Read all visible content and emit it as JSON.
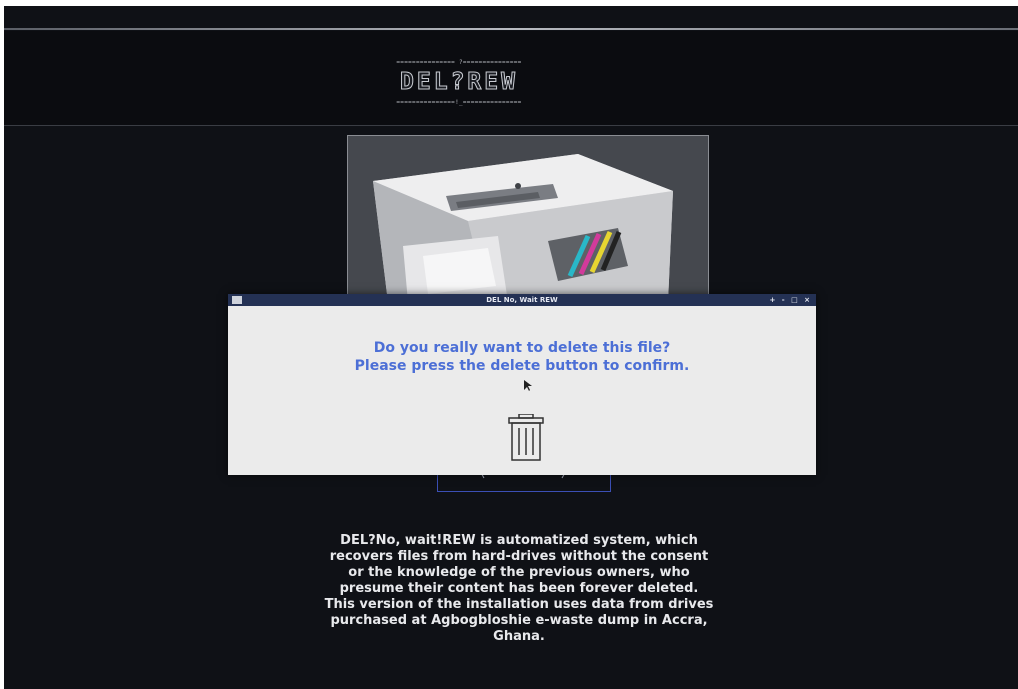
{
  "header": {
    "logo_top_rule": "=============== ?===============",
    "logo_text": "DEL?REW",
    "logo_bottom_rule": "===============!_==============="
  },
  "dialog": {
    "title": "DEL No, Wait REW",
    "controls": "+ - □ ×",
    "message_line1": "Do you really want to delete this file?",
    "message_line2": "Please press the delete button to confirm.",
    "delete_icon": "trash-icon"
  },
  "description": "DEL?No, wait!REW is automatized system, which recovers files from hard-drives without the consent or the knowledge of the previous owners, who presume their content has been forever deleted. This version of the installation uses data from drives purchased at Agbogbloshie e-waste dump in Accra, Ghana.",
  "colors": {
    "background": "#0f1116",
    "titlebar": "#243154",
    "dialog_body": "#ebebeb",
    "message_text": "#4c6fd6"
  }
}
